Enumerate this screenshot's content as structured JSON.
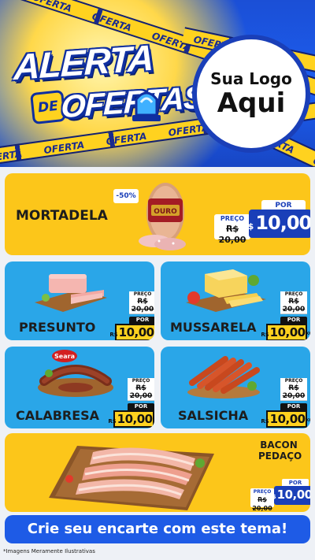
{
  "header": {
    "title_line1": "ALERTA",
    "title_de": "DE",
    "title_line2": "OFERTAS",
    "tape_text": "OFERTA",
    "logo_line1": "Sua Logo",
    "logo_line2": "Aqui"
  },
  "products": {
    "mortadela": {
      "name": "MORTADELA",
      "badge": "-50%",
      "brand": "OURO",
      "was_label": "PREÇO",
      "was_value": "R$ 20,00",
      "now_label": "POR",
      "currency": "R$",
      "now_value": "10,00",
      "unit": "KG"
    },
    "presunto": {
      "name": "PRESUNTO",
      "was_label": "PREÇO",
      "was_value": "R$ 20,00",
      "now_label": "POR",
      "currency": "R$",
      "now_value": "10,00",
      "unit": "KG"
    },
    "mussarela": {
      "name": "MUSSARELA",
      "was_label": "PREÇO",
      "was_value": "R$ 20,00",
      "now_label": "POR",
      "currency": "R$",
      "now_value": "10,00",
      "unit": "KG"
    },
    "calabresa": {
      "name": "CALABRESA",
      "brand": "Seara",
      "was_label": "PREÇO",
      "was_value": "R$ 20,00",
      "now_label": "POR",
      "currency": "R$",
      "now_value": "10,00",
      "unit": "KG"
    },
    "salsicha": {
      "name": "SALSICHA",
      "was_label": "PREÇO",
      "was_value": "R$ 20,00",
      "now_label": "POR",
      "currency": "R$",
      "now_value": "10,00",
      "unit": "KG"
    },
    "bacon": {
      "name_line1": "BACON",
      "name_line2": "PEDAÇO",
      "was_label": "PREÇO",
      "was_value": "R$ 20,00",
      "now_label": "POR",
      "currency": "R$",
      "now_value": "10,00",
      "unit": "KG"
    }
  },
  "cta": "Crie seu encarte com este tema!",
  "disclaimer": "*Imagens Meramente Ilustrativas",
  "colors": {
    "header_blue": "#1c5ef0",
    "brand_yellow": "#fcc61a",
    "card_blue": "#2aa6e8",
    "tag_blue": "#1a3fb8",
    "cta_blue": "#1e5be6"
  }
}
